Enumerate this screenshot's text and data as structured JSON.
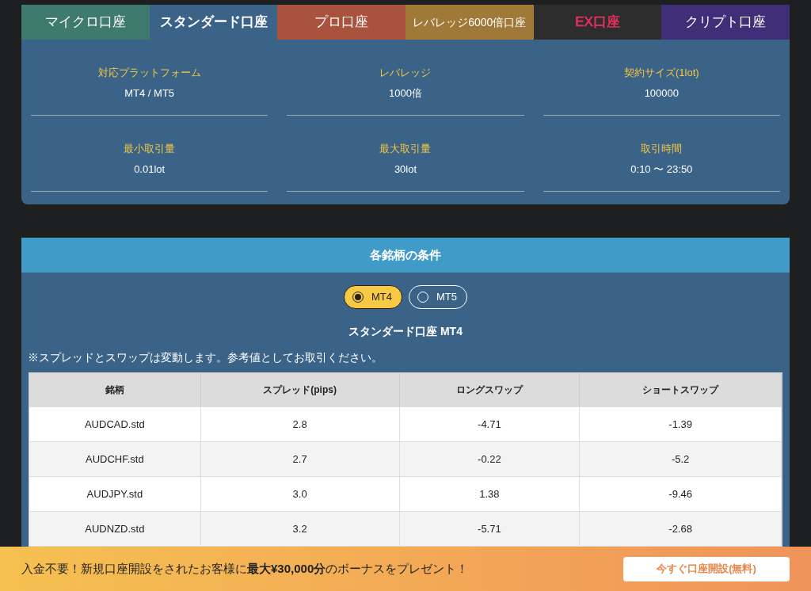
{
  "account_tabs": [
    {
      "label": "マイクロ口座",
      "selected": false,
      "color": "#3f7a6f",
      "kind": "normal"
    },
    {
      "label": "スタンダード口座",
      "selected": true,
      "color": "#3a6387",
      "kind": "normal"
    },
    {
      "label": "プロ口座",
      "selected": false,
      "color": "#a9533e",
      "kind": "normal"
    },
    {
      "label": "レバレッジ6000倍口座",
      "selected": false,
      "color": "#a07838",
      "kind": "small"
    },
    {
      "label": "EX口座",
      "selected": false,
      "color": "#2d2d2d",
      "kind": "highlight"
    },
    {
      "label": "クリプト口座",
      "selected": false,
      "color": "#3f2f78",
      "kind": "normal"
    }
  ],
  "specs": [
    {
      "label": "対応プラットフォーム",
      "value": "MT4 / MT5"
    },
    {
      "label": "レバレッジ",
      "value": "1000倍"
    },
    {
      "label": "契約サイズ(1lot)",
      "value": "100000"
    },
    {
      "label": "最小取引量",
      "value": "0.01lot"
    },
    {
      "label": "最大取引量",
      "value": "30lot"
    },
    {
      "label": "取引時間",
      "value": "0:10 〜 23:50"
    }
  ],
  "conditions": {
    "title": "各銘柄の条件",
    "platforms": [
      {
        "label": "MT4",
        "selected": true
      },
      {
        "label": "MT5",
        "selected": false
      }
    ],
    "table_title": "スタンダード口座 MT4",
    "note": "※スプレッドとスワップは変動します。参考値としてお取引ください。",
    "columns": [
      "銘柄",
      "スプレッド(pips)",
      "ロングスワップ",
      "ショートスワップ"
    ],
    "rows": [
      [
        "AUDCAD.std",
        "2.8",
        "-4.71",
        "-1.39"
      ],
      [
        "AUDCHF.std",
        "2.7",
        "-0.22",
        "-5.2"
      ],
      [
        "AUDJPY.std",
        "3.0",
        "1.38",
        "-9.46"
      ],
      [
        "AUDNZD.std",
        "3.2",
        "-5.71",
        "-2.68"
      ]
    ]
  },
  "banner": {
    "text": "入金不要！新規口座開設をされたお客様に**最大¥30,000分**のボーナスをプレゼント！",
    "button": "今すぐ口座開設(無料)"
  }
}
